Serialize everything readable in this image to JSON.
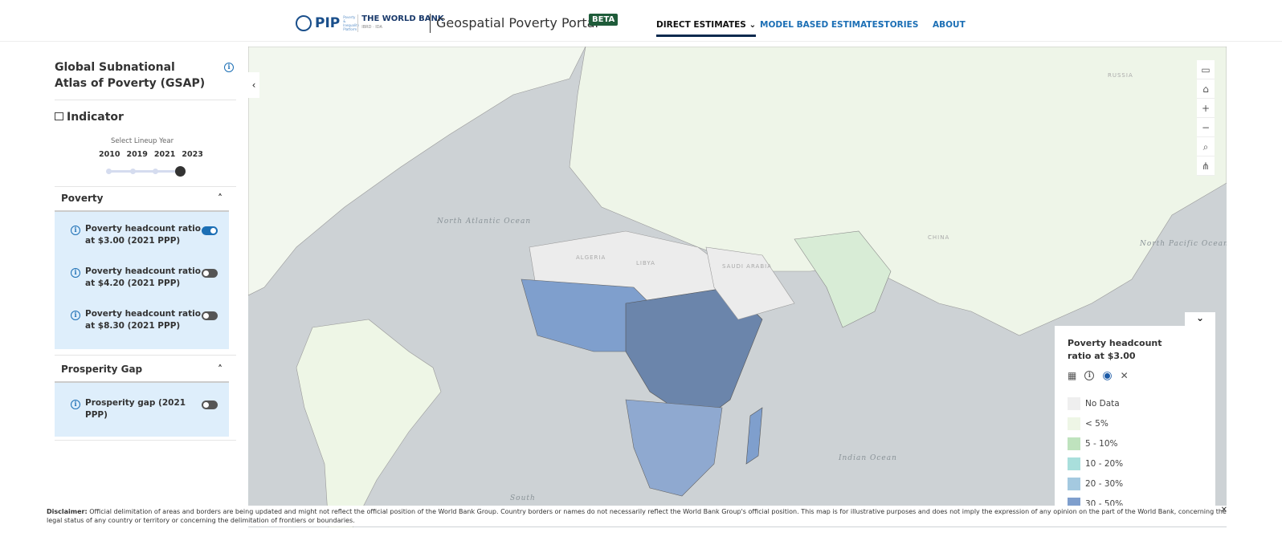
{
  "header": {
    "logo_text": "PIP",
    "logo_sub": "Poverty & Inequality Platform",
    "bank": "THE WORLD BANK",
    "bank_sub": "IBRD · IDA",
    "portal": "Geospatial Poverty Portal",
    "beta": "BETA",
    "nav": [
      {
        "label": "DIRECT ESTIMATES ⌄"
      },
      {
        "label": "MODEL BASED ESTIMATES"
      },
      {
        "label": "STORIES"
      },
      {
        "label": "ABOUT"
      }
    ]
  },
  "sidebar": {
    "title": "Global Subnational Atlas of Poverty (GSAP)",
    "indicator": "Indicator",
    "year_label": "Select Lineup Year",
    "years": [
      "2010",
      "2019",
      "2021",
      "2023"
    ],
    "selected_year": "2023",
    "sections": [
      {
        "title": "Poverty",
        "items": [
          {
            "label": "Poverty headcount ratio at $3.00 (2021 PPP)",
            "on": true
          },
          {
            "label": "Poverty headcount ratio at $4.20 (2021 PPP)",
            "on": false
          },
          {
            "label": "Poverty headcount ratio at $8.30 (2021 PPP)",
            "on": false
          }
        ]
      },
      {
        "title": "Prosperity Gap",
        "items": [
          {
            "label": "Prosperity gap (2021 PPP)",
            "on": false
          }
        ]
      }
    ]
  },
  "map": {
    "labels": [
      "North Atlantic Ocean",
      "North Pacific Ocean",
      "Indian Ocean",
      "South",
      "RUSSIA",
      "CHINA",
      "LIBYA",
      "SAUDI ARABIA",
      "ALGERIA"
    ]
  },
  "legend": {
    "title": "Poverty headcount ratio at $3.00",
    "items": [
      {
        "label": "No Data",
        "color": "#efefef"
      },
      {
        "label": "< 5%",
        "color": "#eef6e6"
      },
      {
        "label": "5 - 10%",
        "color": "#bfe3be"
      },
      {
        "label": "10 - 20%",
        "color": "#a9dfdc"
      },
      {
        "label": "20 - 30%",
        "color": "#a4c9e0"
      },
      {
        "label": "30 - 50%",
        "color": "#7f9fcd"
      }
    ]
  },
  "disclaimer": {
    "bold": "Disclaimer:",
    "text": " Official delimitation of areas and borders are being updated and might not reflect the official position of the World Bank Group. Country borders or names do not necessarily reflect the World Bank Group's official position. This map is for illustrative purposes and does not imply the expression of any opinion on the part of the World Bank, concerning the legal status of any country or territory or concerning the delimitation of frontiers or boundaries."
  }
}
